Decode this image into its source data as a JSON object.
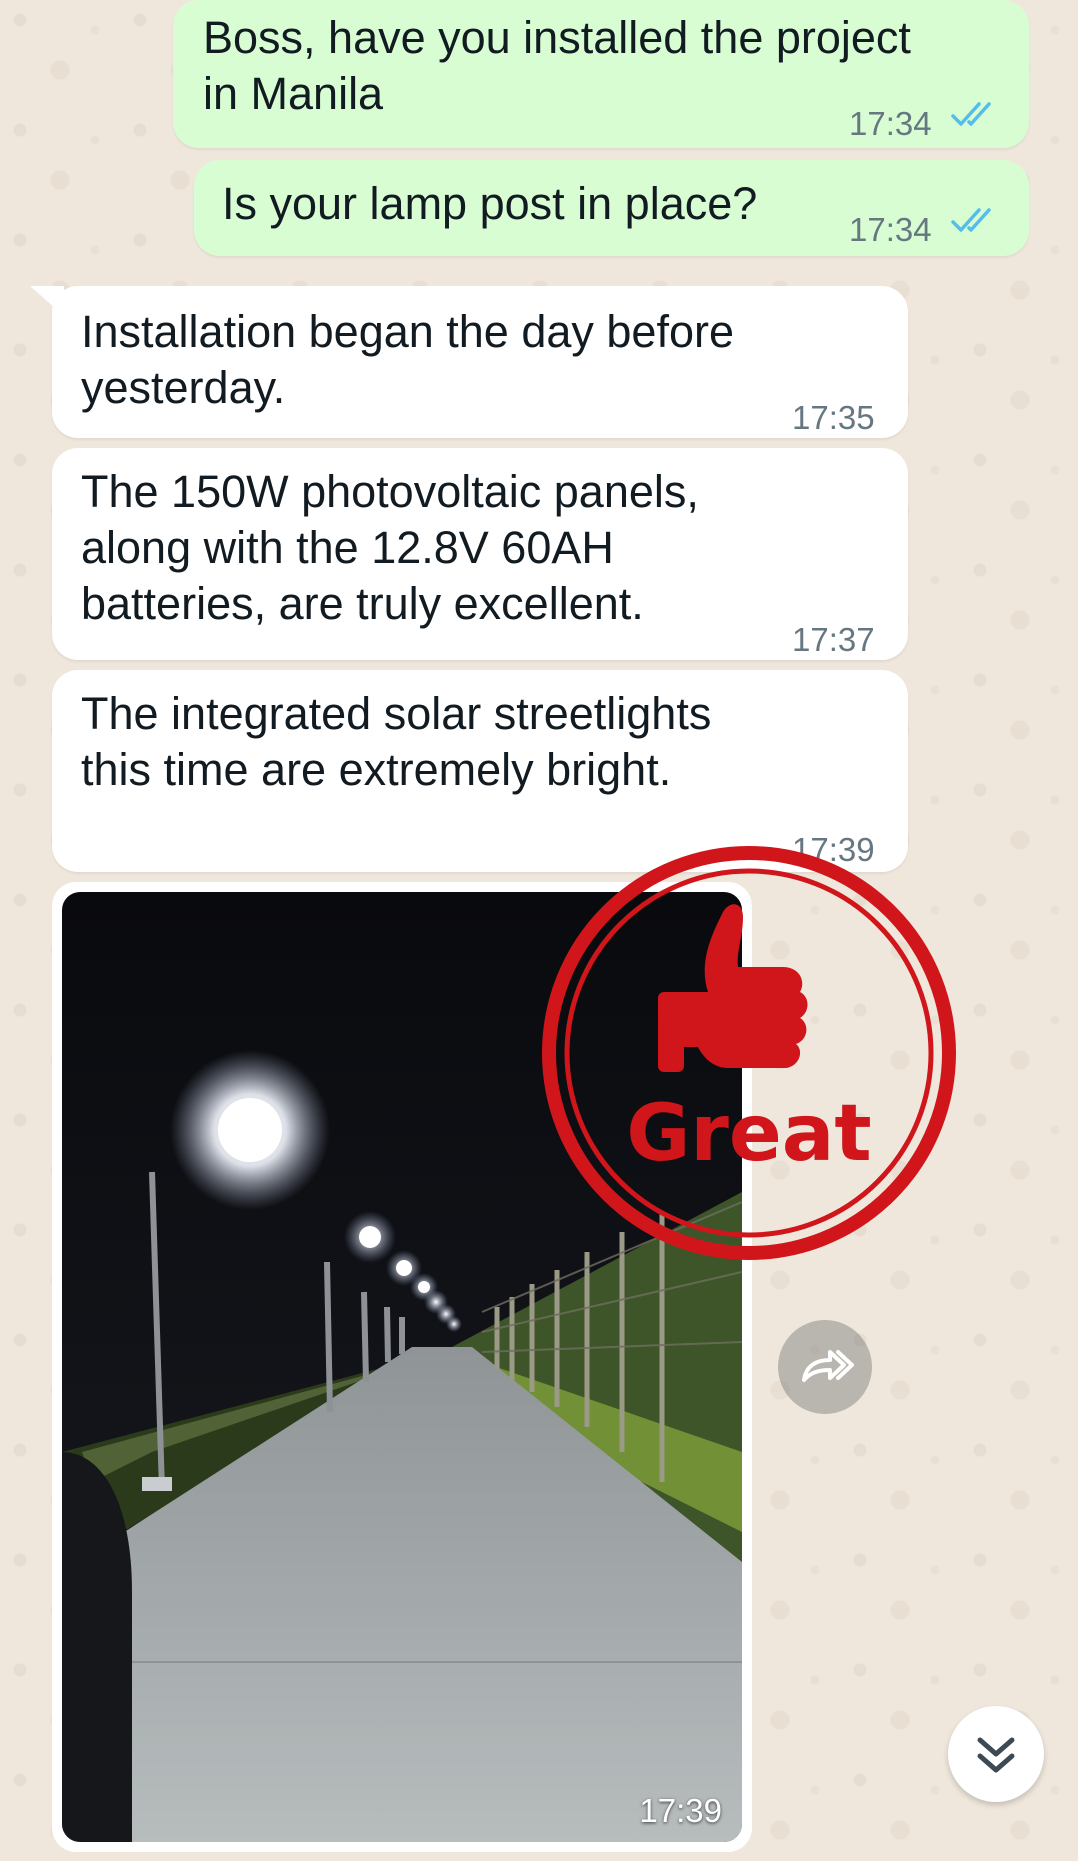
{
  "messages": [
    {
      "text": "Boss, have you installed the project\nin Manila",
      "time": "17:34"
    },
    {
      "text": "Is your lamp post in place?",
      "time": "17:34"
    },
    {
      "text": "Installation began the day before\nyesterday.",
      "time": "17:35"
    },
    {
      "text": "The 150W photovoltaic panels,\nalong with the 12.8V 60AH\nbatteries, are truly excellent.",
      "time": "17:37"
    },
    {
      "text": "The integrated solar streetlights\nthis time are extremely bright.",
      "time": "17:39"
    }
  ],
  "photo": {
    "time": "17:39"
  },
  "stamp": {
    "text": "Great"
  },
  "icons": {
    "read_receipt": "double-check-icon",
    "forward": "forward-icon",
    "scroll_down": "chevron-double-down-icon",
    "stamp": "thumbs-up-icon"
  },
  "colors": {
    "outgoing_bubble": "#d9fdd3",
    "incoming_bubble": "#ffffff",
    "read_tick": "#53bdeb",
    "stamp_red": "#d0161b"
  }
}
